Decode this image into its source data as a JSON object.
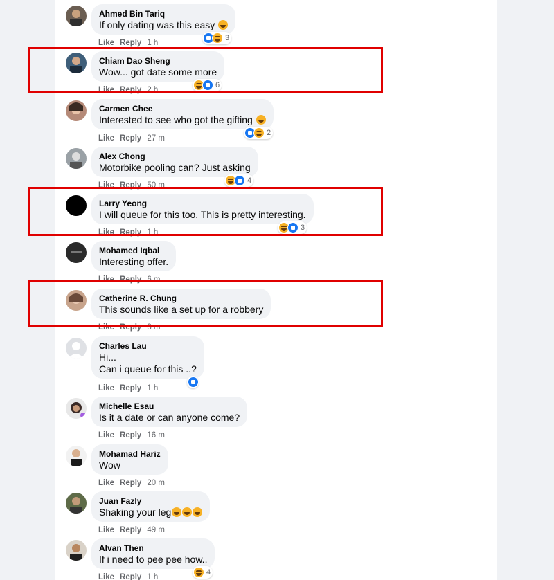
{
  "comments": [
    {
      "author": "Ahmed Bin Tariq",
      "text": "If only dating was this easy",
      "emoji": true,
      "reactions": [
        "like",
        "haha"
      ],
      "count": "3",
      "like": "Like",
      "reply": "Reply",
      "time": "1 h"
    },
    {
      "author": "Chiam Dao Sheng",
      "text": "Wow... got date some more",
      "reactions": [
        "haha",
        "like"
      ],
      "count": "6",
      "like": "Like",
      "reply": "Reply",
      "time": "2 h"
    },
    {
      "author": "Carmen Chee",
      "text": "Interested to see who got the gifting",
      "emoji": true,
      "reactions": [
        "like",
        "haha"
      ],
      "count": "2",
      "like": "Like",
      "reply": "Reply",
      "time": "27 m"
    },
    {
      "author": "Alex Chong",
      "text": "Motorbike pooling can? Just asking",
      "reactions": [
        "haha",
        "like"
      ],
      "count": "4",
      "like": "Like",
      "reply": "Reply",
      "time": "50 m"
    },
    {
      "author": "Larry Yeong",
      "text": "I will queue for this too. This is pretty interesting.",
      "reactions": [
        "haha",
        "like"
      ],
      "count": "3",
      "like": "Like",
      "reply": "Reply",
      "time": "1 h"
    },
    {
      "author": "Mohamed Iqbal",
      "text": "Interesting offer.",
      "reactions": [],
      "count": "",
      "like": "Like",
      "reply": "Reply",
      "time": "6 m"
    },
    {
      "author": "Catherine R. Chung",
      "text": "This sounds like a set up for a robbery",
      "reactions": [],
      "count": "",
      "like": "Like",
      "reply": "Reply",
      "time": "3 m"
    },
    {
      "author": "Charles Lau",
      "text": "Hi...",
      "text2": "Can i queue for this ..?",
      "reactions": [
        "like"
      ],
      "count": "",
      "like": "Like",
      "reply": "Reply",
      "time": "1 h"
    },
    {
      "author": "Michelle Esau",
      "text": "Is it a date or can anyone come?",
      "reactions": [],
      "count": "",
      "like": "Like",
      "reply": "Reply",
      "time": "16 m"
    },
    {
      "author": "Mohamad Hariz",
      "text": "Wow",
      "reactions": [],
      "count": "",
      "like": "Like",
      "reply": "Reply",
      "time": "20 m"
    },
    {
      "author": "Juan Fazly",
      "text": "Shaking your leg",
      "emoji3": true,
      "reactions": [],
      "count": "",
      "like": "Like",
      "reply": "Reply",
      "time": "49 m"
    },
    {
      "author": "Alvan Then",
      "text": "If i need to pee pee how..",
      "reactions": [
        "haha"
      ],
      "count": "4",
      "like": "Like",
      "reply": "Reply",
      "time": "1 h"
    }
  ],
  "colors": {
    "highlight": "#e00000",
    "like_blue": "#1877f2",
    "haha_yellow": "#f7b125",
    "bubble": "#f0f2f5"
  }
}
